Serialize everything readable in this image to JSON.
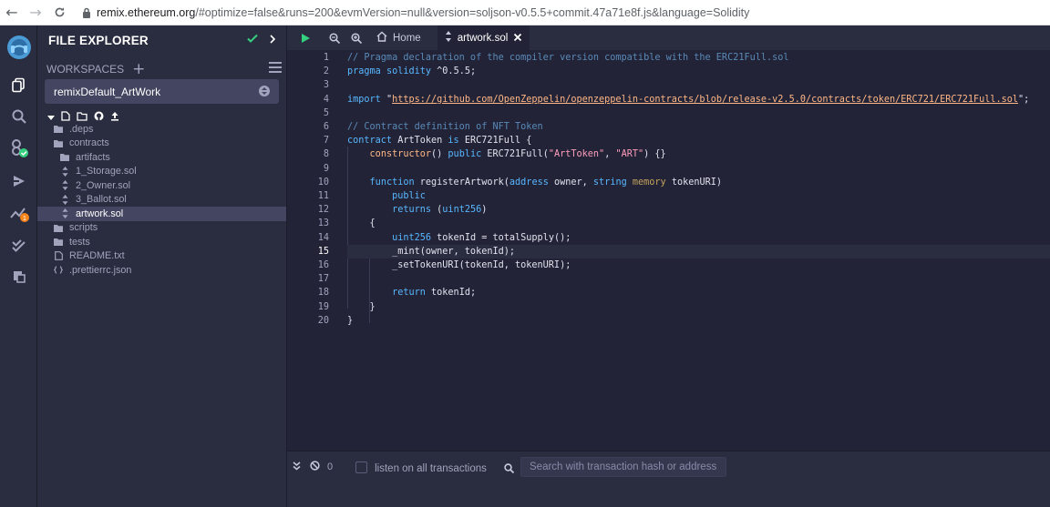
{
  "browser": {
    "url_host": "remix.ethereum.org",
    "url_rest": "/#optimize=false&runs=200&evmVersion=null&version=soljson-v0.5.5+commit.47a71e8f.js&language=Solidity"
  },
  "icon_rail": {
    "items": [
      "remix-logo-icon",
      "file-explorer-icon",
      "search-icon",
      "solidity-compiler-icon",
      "deploy-run-icon",
      "analysis-icon",
      "verified-check-icon",
      "plugin-manager-icon"
    ],
    "badge_count": "1"
  },
  "sidebar": {
    "title": "FILE EXPLORER",
    "workspaces_label": "WORKSPACES",
    "workspace_selected": "remixDefault_ArtWork",
    "tree": [
      {
        "label": ".deps",
        "kind": "folder",
        "depth": 1
      },
      {
        "label": "contracts",
        "kind": "folder",
        "depth": 1
      },
      {
        "label": "artifacts",
        "kind": "folder",
        "depth": 2
      },
      {
        "label": "1_Storage.sol",
        "kind": "sol",
        "depth": 2
      },
      {
        "label": "2_Owner.sol",
        "kind": "sol",
        "depth": 2
      },
      {
        "label": "3_Ballot.sol",
        "kind": "sol",
        "depth": 2
      },
      {
        "label": "artwork.sol",
        "kind": "sol",
        "depth": 2,
        "selected": true
      },
      {
        "label": "scripts",
        "kind": "folder",
        "depth": 1
      },
      {
        "label": "tests",
        "kind": "folder",
        "depth": 1
      },
      {
        "label": "README.txt",
        "kind": "txt",
        "depth": 1
      },
      {
        "label": ".prettierrc.json",
        "kind": "json",
        "depth": 1
      }
    ]
  },
  "tabs": {
    "home_label": "Home",
    "active_file_label": "artwork.sol"
  },
  "editor": {
    "active_line": 15,
    "lines": [
      [
        [
          "comment",
          "// Pragma declaration of the compiler version compatible with the ERC21Full.sol"
        ]
      ],
      [
        [
          "keyword",
          "pragma"
        ],
        [
          "plain",
          " "
        ],
        [
          "keyword",
          "solidity"
        ],
        [
          "plain",
          " ^0.5.5;"
        ]
      ],
      [],
      [
        [
          "keyword",
          "import"
        ],
        [
          "plain",
          " \""
        ],
        [
          "url",
          "https://github.com/OpenZeppelin/openzeppelin-contracts/blob/release-v2.5.0/contracts/token/ERC721/ERC721Full.sol"
        ],
        [
          "plain",
          "\";"
        ]
      ],
      [],
      [
        [
          "comment",
          "// Contract definition of NFT Token"
        ]
      ],
      [
        [
          "keyword",
          "contract"
        ],
        [
          "plain",
          " ArtToken "
        ],
        [
          "keyword",
          "is"
        ],
        [
          "plain",
          " ERC721Full {"
        ]
      ],
      [
        [
          "plain",
          "    "
        ],
        [
          "func",
          "constructor"
        ],
        [
          "plain",
          "() "
        ],
        [
          "keyword",
          "public"
        ],
        [
          "plain",
          " ERC721Full("
        ],
        [
          "string",
          "\"ArtToken\""
        ],
        [
          "plain",
          ", "
        ],
        [
          "string",
          "\"ART\""
        ],
        [
          "plain",
          ") {}"
        ]
      ],
      [],
      [
        [
          "plain",
          "    "
        ],
        [
          "keyword",
          "function"
        ],
        [
          "plain",
          " registerArtwork("
        ],
        [
          "type",
          "address"
        ],
        [
          "plain",
          " owner, "
        ],
        [
          "type",
          "string"
        ],
        [
          "plain",
          " "
        ],
        [
          "storage",
          "memory"
        ],
        [
          "plain",
          " tokenURI)"
        ]
      ],
      [
        [
          "plain",
          "        "
        ],
        [
          "keyword",
          "public"
        ]
      ],
      [
        [
          "plain",
          "        "
        ],
        [
          "keyword",
          "returns"
        ],
        [
          "plain",
          " ("
        ],
        [
          "type",
          "uint256"
        ],
        [
          "plain",
          ")"
        ]
      ],
      [
        [
          "plain",
          "    {"
        ]
      ],
      [
        [
          "plain",
          "        "
        ],
        [
          "type",
          "uint256"
        ],
        [
          "plain",
          " tokenId = totalSupply();"
        ]
      ],
      [
        [
          "plain",
          "        _mint(owner, tokenId);"
        ]
      ],
      [
        [
          "plain",
          "        _setTokenURI(tokenId, tokenURI);"
        ]
      ],
      [],
      [
        [
          "plain",
          "        "
        ],
        [
          "control",
          "return"
        ],
        [
          "plain",
          " tokenId;"
        ]
      ],
      [
        [
          "plain",
          "    }"
        ]
      ],
      [
        [
          "plain",
          "}"
        ]
      ]
    ]
  },
  "terminal": {
    "count": "0",
    "listen_label": "listen on all transactions",
    "search_placeholder": "Search with transaction hash or address"
  },
  "colors": {
    "accent_green": "#35d07f",
    "accent_blue": "#58b7ff",
    "badge_orange": "#f6851b"
  }
}
